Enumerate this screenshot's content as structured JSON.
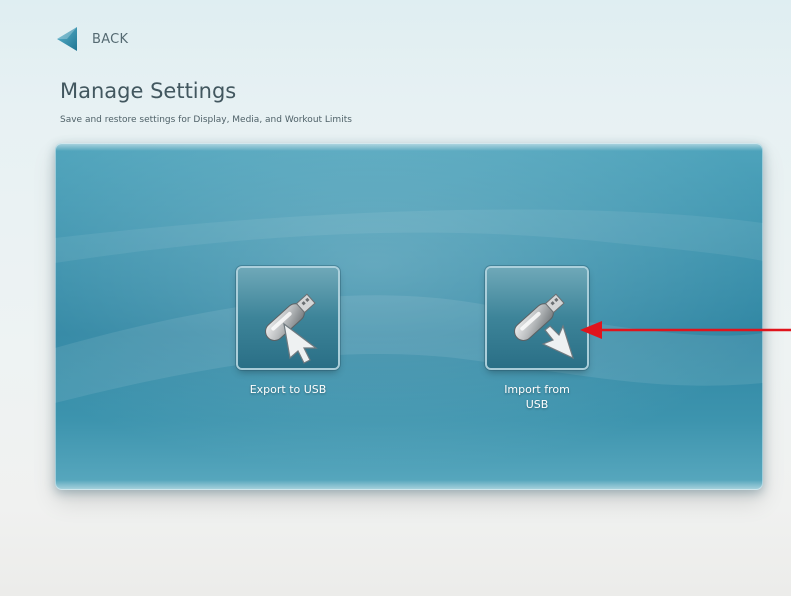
{
  "header": {
    "back_label": "BACK",
    "back_icon": "back-arrow-icon",
    "title": "Manage Settings",
    "subtitle": "Save and restore settings for Display, Media, and Workout Limits"
  },
  "actions": {
    "export": {
      "label": "Export to USB",
      "icon": "usb-export-icon"
    },
    "import": {
      "label": "Import from\nUSB",
      "icon": "usb-import-icon"
    }
  },
  "annotation": {
    "type": "arrow",
    "color": "#e0141c",
    "points_to": "import"
  },
  "colors": {
    "accent": "#3c93ae",
    "title_text": "#42575f",
    "back_arrow": "#2f8eab",
    "annotation_arrow": "#e0141c"
  }
}
